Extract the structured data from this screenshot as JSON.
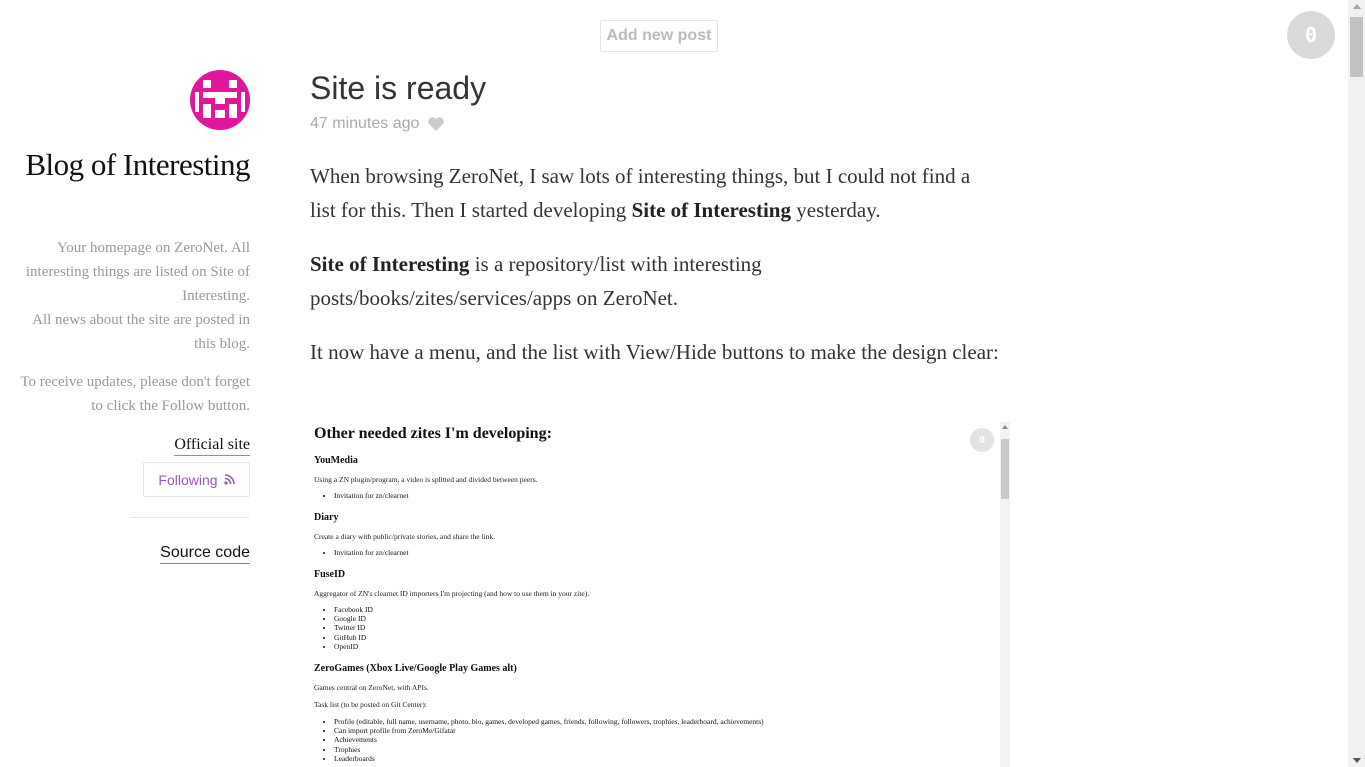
{
  "header": {
    "add_post_label": "Add new post",
    "notification_count": "0"
  },
  "sidebar": {
    "blog_title": "Blog of Interesting",
    "description_lines": [
      "Your homepage on ZeroNet. All interesting things are listed on Site of Interesting.",
      "All news about the site are posted in this blog."
    ],
    "follow_note": "To receive updates, please don't forget to click the Follow button.",
    "official_link": "Official site",
    "follow_label": "Following",
    "source_link": "Source code",
    "colors": {
      "avatar": "#e0179a",
      "follow_text": "#9b59b6",
      "official_underline": "#2ecc71",
      "source_underline": "#3498db"
    }
  },
  "post": {
    "title": "Site is ready",
    "time": "47 minutes ago",
    "p1_a": "When browsing ZeroNet, I saw lots of interesting things, but I could not find a list for this. Then I started developing ",
    "p1_bold": "Site of Interesting",
    "p1_b": " yesterday.",
    "p2_bold": "Site of Interesting",
    "p2_a": " is a repository/list with interesting posts/books/zites/services/apps on ZeroNet.",
    "p3": "It now have a menu, and the list with View/Hide buttons to make the design clear:"
  },
  "embed": {
    "heading": "Other needed zites I'm developing:",
    "badge": "0",
    "sections": [
      {
        "title": "YouMedia",
        "desc": "Using a ZN plugin/program, a video is splitted and divided between peers.",
        "items": [
          "Invitation for zn/clearnet"
        ]
      },
      {
        "title": "Diary",
        "desc": "Create a diary with public/private stories, and share the link.",
        "items": [
          "Invitation for zn/clearnet"
        ]
      },
      {
        "title": "FuseID",
        "desc": "Aggregator of ZN's clearnet ID importers I'm projecting (and how to use them in your zite).",
        "items": [
          "Facebook ID",
          "Google ID",
          "Twitter ID",
          "GitHub ID",
          "OpenID"
        ]
      },
      {
        "title": "ZeroGames (Xbox Live/Google Play Games alt)",
        "desc": "Games central on ZeroNet, with APIs.",
        "desc2": "Task list (to be posted on Git Center):",
        "items": [
          "Profile (editable, full name, username, photo, bio, games, developed games, friends, following, followers, trophies, leaderboard, achievements)",
          "Can import profile from ZeroMe/Gifatar",
          "Achievements",
          "Trophies",
          "Leaderboards"
        ]
      }
    ]
  }
}
